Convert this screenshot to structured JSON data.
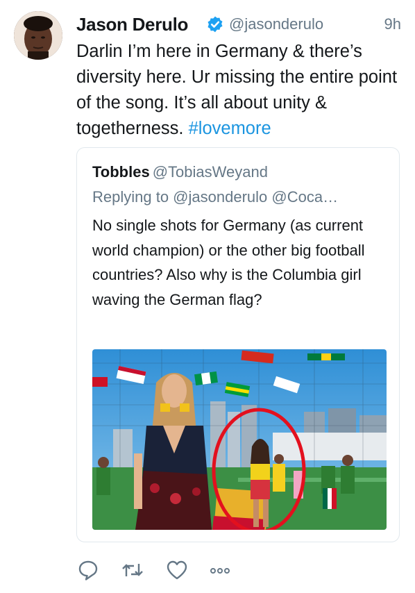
{
  "tweet": {
    "author_name": "Jason Derulo",
    "handle": "@jasonderulo",
    "time": "9h",
    "text_main": "Darlin I’m here in Germany & there’s diversity here. Ur missing the entire point of the song. It’s all about unity & togetherness. ",
    "hashtag": "#lovemore"
  },
  "quoted": {
    "author_name": "Tobbles",
    "handle": "@TobiasWeyand",
    "replying_to": "Replying to @jasonderulo @Coca…",
    "text": "No single shots for Germany (as current world champion) or the other big football countries? Also why is the Columbia girl waving the German flag?"
  },
  "actions": {
    "icons": [
      "reply-icon",
      "retweet-icon",
      "like-icon",
      "more-icon"
    ]
  },
  "colors": {
    "link": "#1b95e0",
    "secondary_text": "#657786",
    "verified": "#1da1f2",
    "border": "#e1e8ed"
  }
}
